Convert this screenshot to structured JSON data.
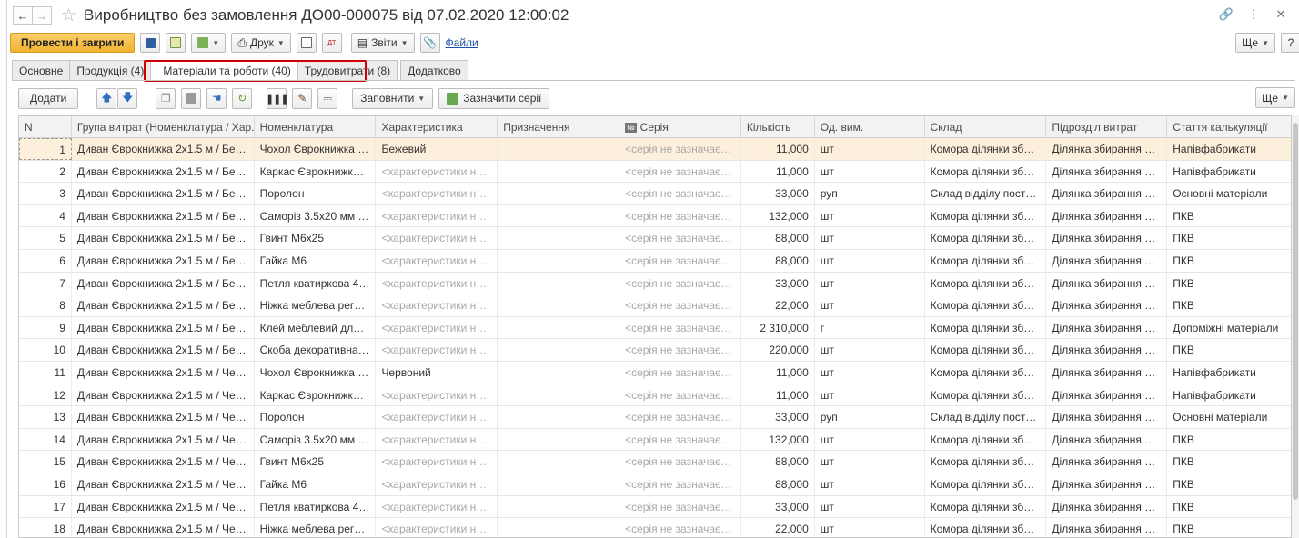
{
  "window": {
    "title": "Виробництво без замовлення ДО00-000075 від 07.02.2020 12:00:02"
  },
  "cmdbar": {
    "post_close": "Провести і закрити",
    "print": "Друк",
    "reports": "Звіти",
    "files": "Файли",
    "more": "Ще"
  },
  "tabs": [
    {
      "label": "Основне"
    },
    {
      "label": "Продукція (4)"
    },
    {
      "label": "Матеріали та роботи (40)"
    },
    {
      "label": "Трудовитрати (8)"
    },
    {
      "label": "Додатково"
    }
  ],
  "subbar": {
    "add": "Додати",
    "fill": "Заповнити",
    "set_series": "Зазначити серії",
    "more": "Ще"
  },
  "table": {
    "columns": [
      "N",
      "Група витрат (Номенклатура / Хар...",
      "Номенклатура",
      "Характеристика",
      "Призначення",
      "Серія",
      "Кількість",
      "Од. вим.",
      "Склад",
      "Підрозділ витрат",
      "Стаття калькуляції"
    ],
    "series_badge": "№",
    "rows": [
      {
        "n": "1",
        "group": "Диван Єврокнижка 2х1.5 м / Беже...",
        "item": "Чохол Єврокнижка 2...",
        "char": "Бежевий",
        "purpose": "",
        "series": "<серія не зазначаєть...",
        "qty": "11,000",
        "unit": "шт",
        "store": "Комора ділянки збир...",
        "dept": "Ділянка збирання м'я...",
        "article": "Напівфабрикати"
      },
      {
        "n": "2",
        "group": "Диван Єврокнижка 2х1.5 м / Беже...",
        "item": "Каркас Єврокнижка ...",
        "char": "<характеристики не ...",
        "purpose": "",
        "series": "<серія не зазначаєть...",
        "qty": "11,000",
        "unit": "шт",
        "store": "Комора ділянки збир...",
        "dept": "Ділянка збирання м'я...",
        "article": "Напівфабрикати"
      },
      {
        "n": "3",
        "group": "Диван Єврокнижка 2х1.5 м / Беже...",
        "item": "Поролон",
        "char": "<характеристики не ...",
        "purpose": "",
        "series": "<серія не зазначаєть...",
        "qty": "33,000",
        "unit": "руп",
        "store": "Склад відділу постач...",
        "dept": "Ділянка збирання м'я...",
        "article": " Основні матеріали"
      },
      {
        "n": "4",
        "group": "Диван Єврокнижка 2х1.5 м / Беже...",
        "item": "Саморіз 3.5х20 мм о...",
        "char": "<характеристики не ...",
        "purpose": "",
        "series": "<серія не зазначаєть...",
        "qty": "132,000",
        "unit": "шт",
        "store": "Комора ділянки збир...",
        "dept": "Ділянка збирання м'я...",
        "article": "ПКВ"
      },
      {
        "n": "5",
        "group": "Диван Єврокнижка 2х1.5 м / Беже...",
        "item": "Гвинт М6х25",
        "char": "<характеристики не ...",
        "purpose": "",
        "series": "<серія не зазначаєть...",
        "qty": "88,000",
        "unit": "шт",
        "store": "Комора ділянки збир...",
        "dept": "Ділянка збирання м'я...",
        "article": "ПКВ"
      },
      {
        "n": "6",
        "group": "Диван Єврокнижка 2х1.5 м / Беже...",
        "item": "Гайка М6",
        "char": "<характеристики не ...",
        "purpose": "",
        "series": "<серія не зазначаєть...",
        "qty": "88,000",
        "unit": "шт",
        "store": "Комора ділянки збир...",
        "dept": "Ділянка збирання м'я...",
        "article": "ПКВ"
      },
      {
        "n": "7",
        "group": "Диван Єврокнижка 2х1.5 м / Беже...",
        "item": "Петля кватиркова 40...",
        "char": "<характеристики не ...",
        "purpose": "",
        "series": "<серія не зазначаєть...",
        "qty": "33,000",
        "unit": "шт",
        "store": "Комора ділянки збир...",
        "dept": "Ділянка збирання м'я...",
        "article": "ПКВ"
      },
      {
        "n": "8",
        "group": "Диван Єврокнижка 2х1.5 м / Беже...",
        "item": "Ніжка меблева регул...",
        "char": "<характеристики не ...",
        "purpose": "",
        "series": "<серія не зазначаєть...",
        "qty": "22,000",
        "unit": "шт",
        "store": "Комора ділянки збир...",
        "dept": "Ділянка збирання м'я...",
        "article": "ПКВ"
      },
      {
        "n": "9",
        "group": "Диван Єврокнижка 2х1.5 м / Беже...",
        "item": "Клей меблевий для п...",
        "char": "<характеристики не ...",
        "purpose": "",
        "series": "<серія не зазначаєть...",
        "qty": "2 310,000",
        "unit": "г",
        "store": "Комора ділянки збир...",
        "dept": "Ділянка збирання м'я...",
        "article": "Допоміжні матеріали"
      },
      {
        "n": "10",
        "group": "Диван Єврокнижка 2х1.5 м / Беже...",
        "item": "Скоба декоративна м...",
        "char": "<характеристики не ...",
        "purpose": "",
        "series": "<серія не зазначаєть...",
        "qty": "220,000",
        "unit": "шт",
        "store": "Комора ділянки збир...",
        "dept": "Ділянка збирання м'я...",
        "article": "ПКВ"
      },
      {
        "n": "11",
        "group": "Диван Єврокнижка 2х1.5 м / Черв...",
        "item": "Чохол Єврокнижка 2...",
        "char": "Червоний",
        "purpose": "",
        "series": "<серія не зазначаєть...",
        "qty": "11,000",
        "unit": "шт",
        "store": "Комора ділянки збир...",
        "dept": "Ділянка збирання м'я...",
        "article": "Напівфабрикати"
      },
      {
        "n": "12",
        "group": "Диван Єврокнижка 2х1.5 м / Черв...",
        "item": "Каркас Єврокнижка ...",
        "char": "<характеристики не ...",
        "purpose": "",
        "series": "<серія не зазначаєть...",
        "qty": "11,000",
        "unit": "шт",
        "store": "Комора ділянки збир...",
        "dept": "Ділянка збирання м'я...",
        "article": "Напівфабрикати"
      },
      {
        "n": "13",
        "group": "Диван Єврокнижка 2х1.5 м / Черв...",
        "item": "Поролон",
        "char": "<характеристики не ...",
        "purpose": "",
        "series": "<серія не зазначаєть...",
        "qty": "33,000",
        "unit": "руп",
        "store": "Склад відділу постач...",
        "dept": "Ділянка збирання м'я...",
        "article": " Основні матеріали"
      },
      {
        "n": "14",
        "group": "Диван Єврокнижка 2х1.5 м / Черв...",
        "item": "Саморіз 3.5х20 мм о...",
        "char": "<характеристики не ...",
        "purpose": "",
        "series": "<серія не зазначаєть...",
        "qty": "132,000",
        "unit": "шт",
        "store": "Комора ділянки збир...",
        "dept": "Ділянка збирання м'я...",
        "article": "ПКВ"
      },
      {
        "n": "15",
        "group": "Диван Єврокнижка 2х1.5 м / Черв...",
        "item": "Гвинт М6х25",
        "char": "<характеристики не ...",
        "purpose": "",
        "series": "<серія не зазначаєть...",
        "qty": "88,000",
        "unit": "шт",
        "store": "Комора ділянки збир...",
        "dept": "Ділянка збирання м'я...",
        "article": "ПКВ"
      },
      {
        "n": "16",
        "group": "Диван Єврокнижка 2х1.5 м / Черв...",
        "item": "Гайка М6",
        "char": "<характеристики не ...",
        "purpose": "",
        "series": "<серія не зазначаєть...",
        "qty": "88,000",
        "unit": "шт",
        "store": "Комора ділянки збир...",
        "dept": "Ділянка збирання м'я...",
        "article": "ПКВ"
      },
      {
        "n": "17",
        "group": "Диван Єврокнижка 2х1.5 м / Черв...",
        "item": "Петля кватиркова 40...",
        "char": "<характеристики не ...",
        "purpose": "",
        "series": "<серія не зазначаєть...",
        "qty": "33,000",
        "unit": "шт",
        "store": "Комора ділянки збир...",
        "dept": "Ділянка збирання м'я...",
        "article": "ПКВ"
      },
      {
        "n": "18",
        "group": "Диван Єврокнижка 2х1.5 м / Черв...",
        "item": "Ніжка меблева регул...",
        "char": "<характеристики не ...",
        "purpose": "",
        "series": "<серія не зазначаєть...",
        "qty": "22,000",
        "unit": "шт",
        "store": "Комора ділянки збир...",
        "dept": "Ділянка збирання м'я...",
        "article": "ПКВ"
      }
    ]
  },
  "colors": {
    "primary_button": "#f1b22f",
    "selected_row": "#fcefdc",
    "highlight_box": "#d20000",
    "link": "#1b4fa8"
  }
}
